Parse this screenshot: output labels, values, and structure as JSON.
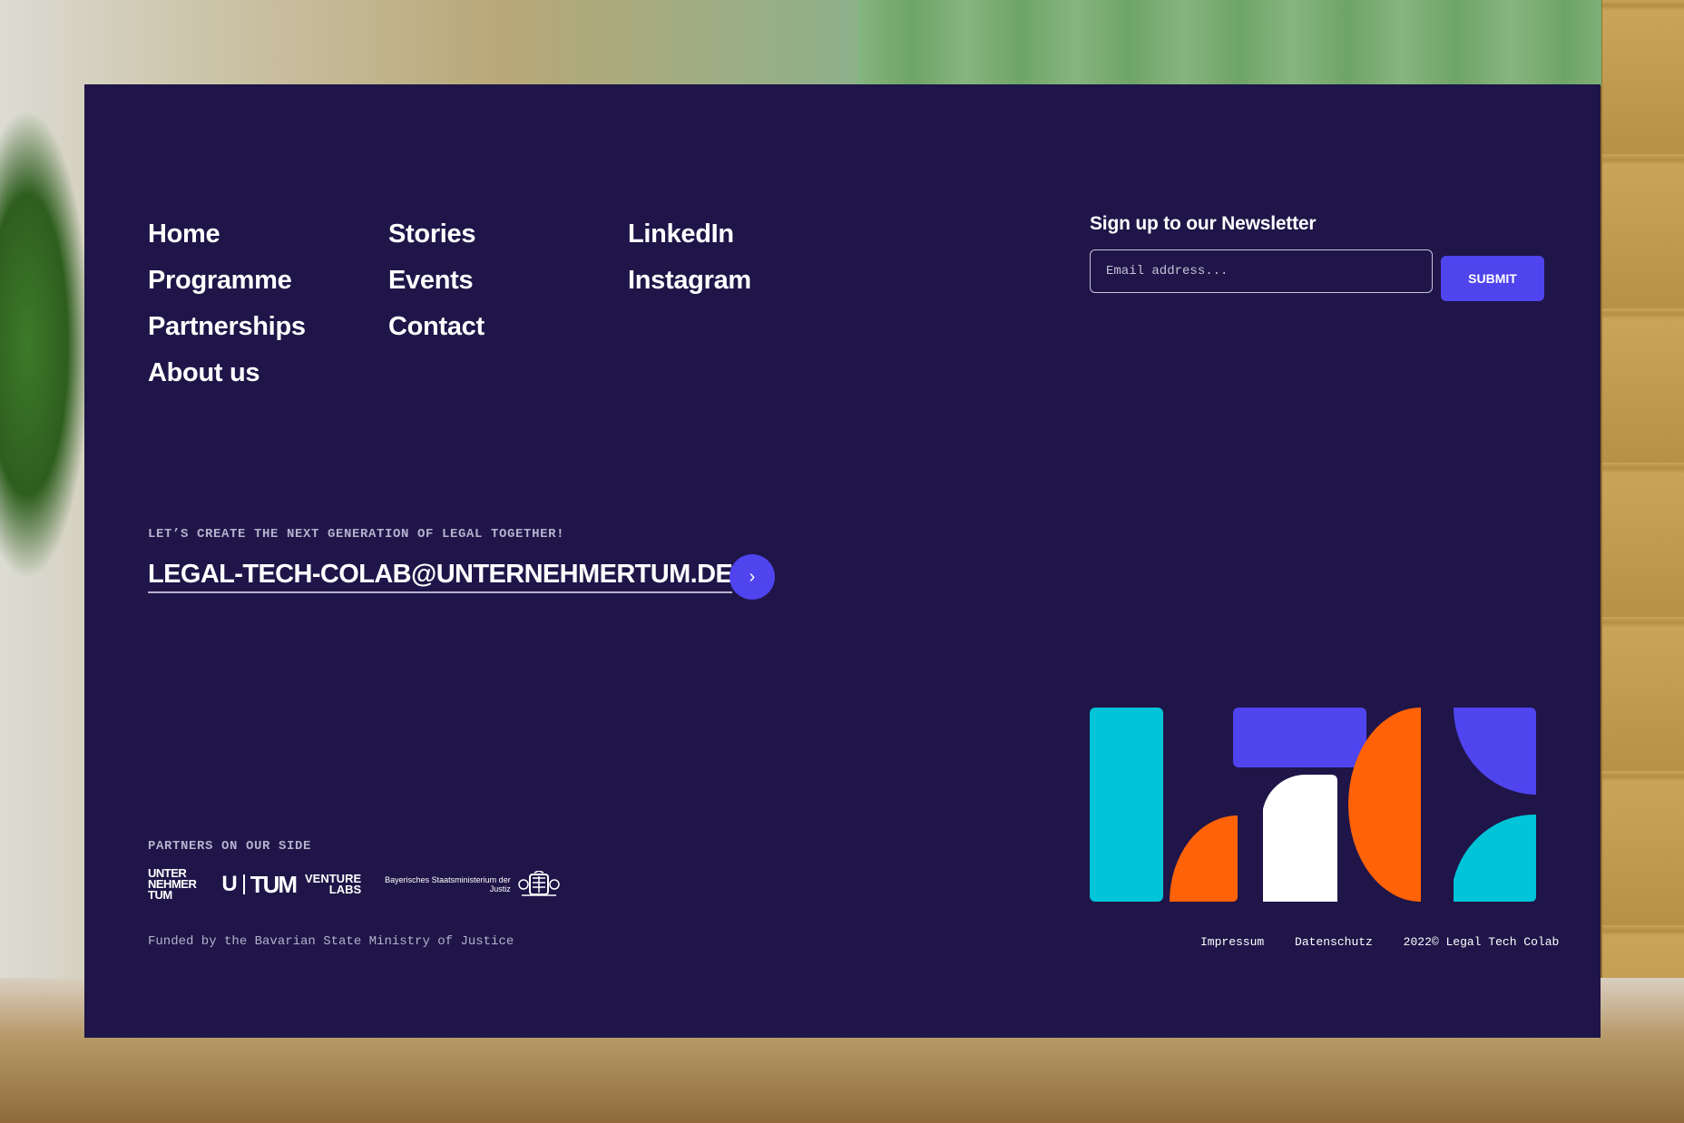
{
  "nav": {
    "col1": [
      "Home",
      "Programme",
      "Partnerships",
      "About us"
    ],
    "col2": [
      "Stories",
      "Events",
      "Contact"
    ],
    "col3": [
      "LinkedIn",
      "Instagram"
    ]
  },
  "newsletter": {
    "title": "Sign up to our Newsletter",
    "placeholder": "Email address...",
    "submit_label": "SUBMIT"
  },
  "cta": {
    "eyebrow": "LET’S CREATE THE NEXT GENERATION OF LEGAL TOGETHER!",
    "email": "LEGAL-TECH-COLAB@UNTERNEHMERTUM.DE",
    "arrow": "›"
  },
  "partners": {
    "label": "PARTNERS ON OUR SIDE",
    "logos": {
      "unternehmer": [
        "UNTER",
        "NEHMER",
        "TUM"
      ],
      "tum_u": "U",
      "tum": "TUM",
      "venture": [
        "VENTURE",
        "LABS"
      ],
      "ministry": [
        "Bayerisches Staatsministerium der",
        "Justiz"
      ]
    }
  },
  "funded": "Funded by the Bavarian State Ministry of Justice",
  "legal": [
    "Impressum",
    "Datenschutz",
    "2022© Legal Tech Colab"
  ],
  "colors": {
    "panel": "#1f1548",
    "accent": "#4f44ee",
    "cyan": "#00c4d8",
    "orange": "#ff6207",
    "white": "#ffffff"
  }
}
